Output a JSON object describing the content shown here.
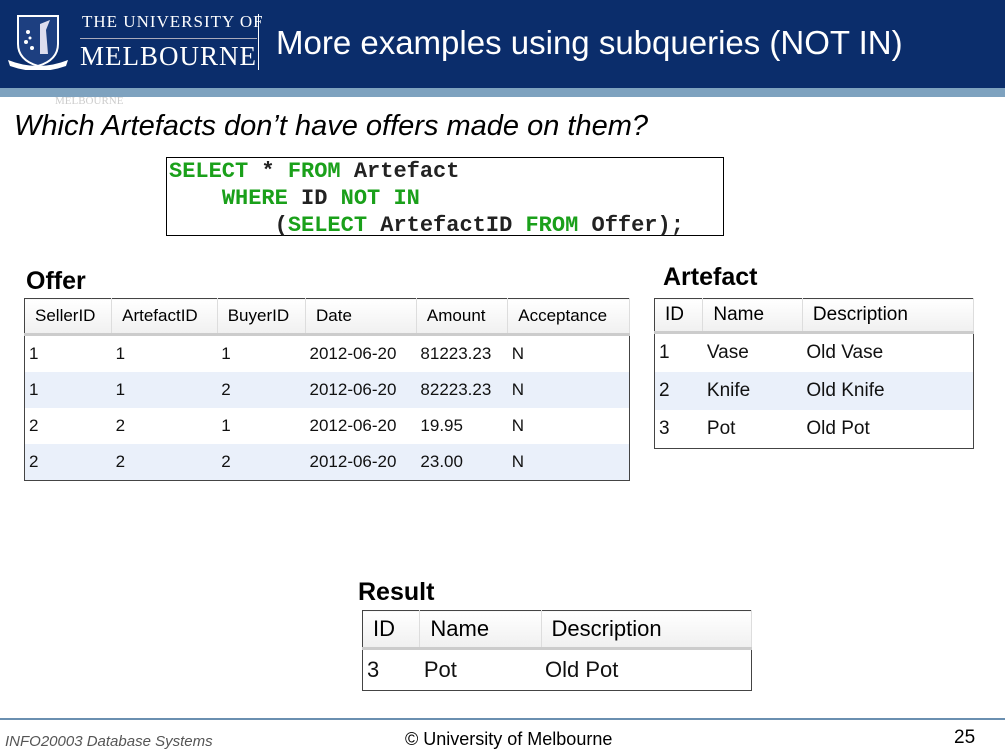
{
  "header": {
    "logo_line1": "THE UNIVERSITY OF",
    "logo_line2": "MELBOURNE",
    "title": "More examples using subqueries (NOT IN)",
    "ghost": "MELBOURNE"
  },
  "question": "Which Artefacts don’t have offers made on them?",
  "sql": {
    "l1_kw1": "SELECT",
    "l1_t1": " * ",
    "l1_kw2": "FROM",
    "l1_t2": " Artefact",
    "l2_kw1": "WHERE",
    "l2_t1": " ID ",
    "l2_kw2": "NOT IN",
    "l3_t1": "(",
    "l3_kw1": "SELECT",
    "l3_t2": " ArtefactID ",
    "l3_kw2": "FROM",
    "l3_t3": " Offer);"
  },
  "offer": {
    "label": "Offer",
    "columns": [
      "SellerID",
      "ArtefactID",
      "BuyerID",
      "Date",
      "Amount",
      "Acceptance"
    ],
    "rows": [
      [
        "1",
        "1",
        "1",
        "2012-06-20",
        "81223.23",
        "N"
      ],
      [
        "1",
        "1",
        "2",
        "2012-06-20",
        "82223.23",
        "N"
      ],
      [
        "2",
        "2",
        "1",
        "2012-06-20",
        "19.95",
        "N"
      ],
      [
        "2",
        "2",
        "2",
        "2012-06-20",
        "23.00",
        "N"
      ]
    ]
  },
  "artefact": {
    "label": "Artefact",
    "columns": [
      "ID",
      "Name",
      "Description"
    ],
    "rows": [
      [
        "1",
        "Vase",
        "Old Vase"
      ],
      [
        "2",
        "Knife",
        "Old Knife"
      ],
      [
        "3",
        "Pot",
        "Old Pot"
      ]
    ]
  },
  "result": {
    "label": "Result",
    "columns": [
      "ID",
      "Name",
      "Description"
    ],
    "rows": [
      [
        "3",
        "Pot",
        "Old Pot"
      ]
    ]
  },
  "footer": {
    "course": "INFO20003 Database Systems",
    "copyright": "© University of Melbourne",
    "page": "25"
  }
}
